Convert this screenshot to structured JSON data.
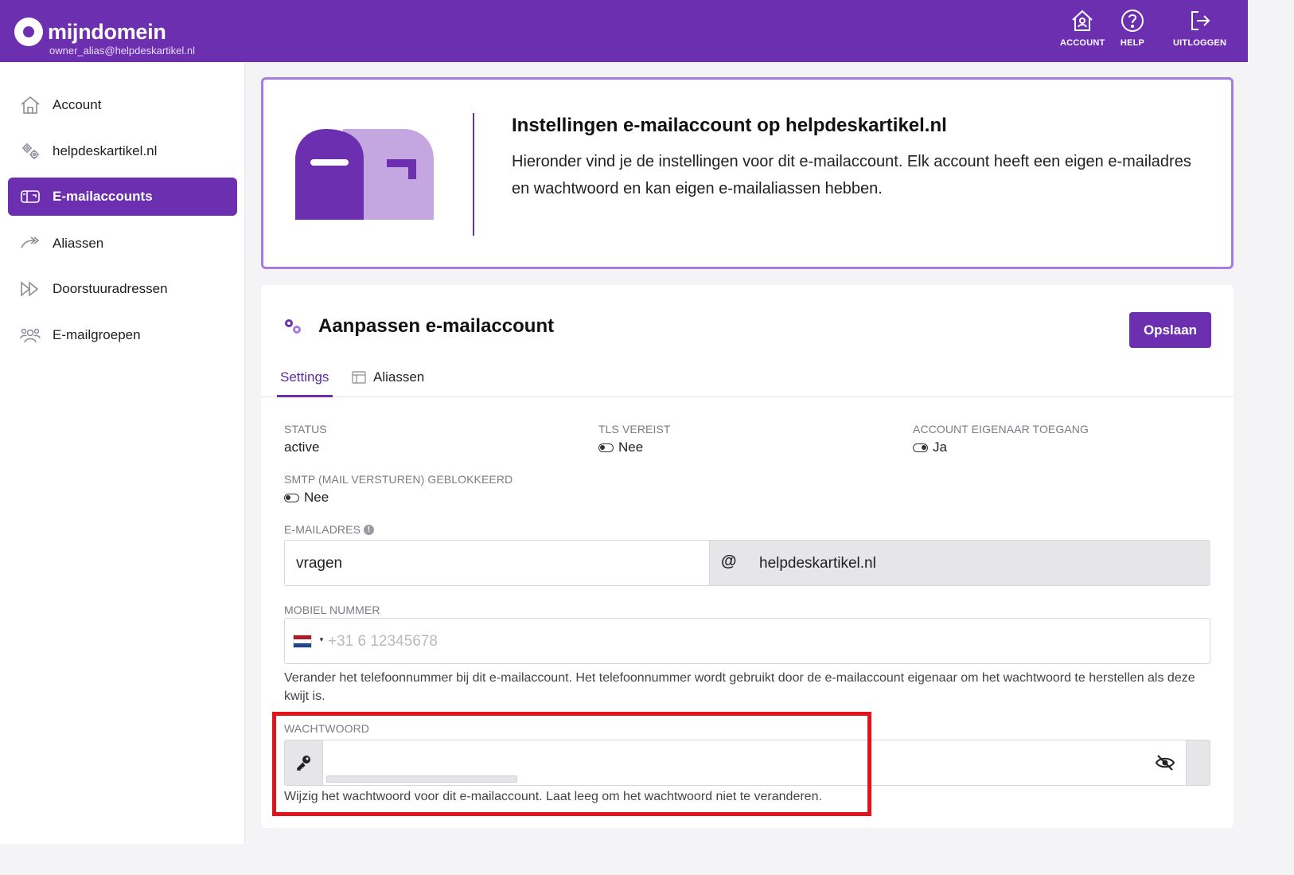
{
  "header": {
    "brand": "mijndomein",
    "user": "owner_alias@helpdeskartikel.nl",
    "nav": [
      {
        "label": "ACCOUNT",
        "icon": "home-user-icon"
      },
      {
        "label": "HELP",
        "icon": "help-circle-icon"
      },
      {
        "label": "UITLOGGEN",
        "icon": "logout-icon"
      }
    ]
  },
  "sidebar": {
    "items": [
      {
        "label": "Account",
        "icon": "home-icon"
      },
      {
        "label": "helpdeskartikel.nl",
        "icon": "settings-gears-icon"
      },
      {
        "label": "E-mailaccounts",
        "icon": "mailbox-icon",
        "active": true
      },
      {
        "label": "Aliassen",
        "icon": "forward-arrow-icon"
      },
      {
        "label": "Doorstuuradressen",
        "icon": "fast-forward-icon"
      },
      {
        "label": "E-mailgroepen",
        "icon": "users-group-icon"
      }
    ]
  },
  "hero": {
    "title": "Instellingen e-mailaccount op helpdeskartikel.nl",
    "text": "Hieronder vind je de instellingen voor dit e-mailaccount. Elk account heeft een eigen e-mailadres en wachtwoord en kan eigen e-mailaliassen hebben."
  },
  "edit": {
    "title": "Aanpassen e-mailaccount",
    "save_label": "Opslaan",
    "tabs": [
      {
        "label": "Settings",
        "active": true
      },
      {
        "label": "Aliassen",
        "active": false
      }
    ],
    "status_label": "STATUS",
    "status_value": "active",
    "tls_label": "TLS VEREIST",
    "tls_value": "Nee",
    "owner_access_label": "ACCOUNT EIGENAAR TOEGANG",
    "owner_access_value": "Ja",
    "smtp_label": "SMTP (MAIL VERSTUREN) GEBLOKKEERD",
    "smtp_value": "Nee",
    "email_label": "E-MAILADRES",
    "email_local": "vragen",
    "email_at": "@",
    "email_domain": "helpdeskartikel.nl",
    "mobile_label": "MOBIEL NUMMER",
    "mobile_placeholder": "+31 6 12345678",
    "mobile_help": "Verander het telefoonnummer bij dit e-mailaccount. Het telefoonnummer wordt gebruikt door de e-mailaccount eigenaar om het wachtwoord te herstellen als deze kwijt is.",
    "password_label": "WACHTWOORD",
    "password_value": "",
    "password_help": "Wijzig het wachtwoord voor dit e-mailaccount. Laat leeg om het wachtwoord niet te veranderen."
  },
  "colors": {
    "brand": "#6c2fb0",
    "hero_border": "#a77be0",
    "highlight": "#e1141c"
  }
}
